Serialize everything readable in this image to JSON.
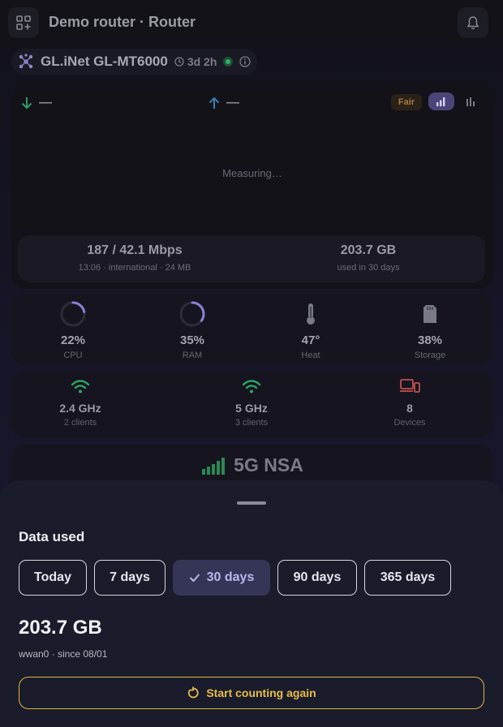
{
  "header": {
    "title": "Demo router · Router",
    "menu_icon": "apps-grid-icon",
    "bell_icon": "bell-icon"
  },
  "device": {
    "name": "GL.iNet GL-MT6000",
    "uptime": "3d 2h",
    "status": "online"
  },
  "speed": {
    "download_value": "—",
    "upload_value": "—",
    "quality_badge": "Fair",
    "measuring_text": "Measuring…",
    "last_test": {
      "value": "187 / 42.1 Mbps",
      "detail": "13:06 · international · 24 MB"
    },
    "usage": {
      "value": "203.7 GB",
      "detail": "used in 30 days"
    }
  },
  "resources": [
    {
      "value": "22%",
      "label": "CPU",
      "level": 0.22
    },
    {
      "value": "35%",
      "label": "RAM",
      "level": 0.35
    },
    {
      "value": "47°",
      "label": "Heat"
    },
    {
      "value": "38%",
      "label": "Storage"
    }
  ],
  "network": [
    {
      "value": "2.4 GHz",
      "label": "2 clients"
    },
    {
      "value": "5 GHz",
      "label": "3 clients"
    },
    {
      "value": "8",
      "label": "Devices"
    }
  ],
  "cellular": {
    "mode": "5G NSA",
    "signal_bars": 5
  },
  "sheet": {
    "title": "Data used",
    "ranges": [
      {
        "label": "Today",
        "selected": false
      },
      {
        "label": "7 days",
        "selected": false
      },
      {
        "label": "30 days",
        "selected": true
      },
      {
        "label": "90 days",
        "selected": false
      },
      {
        "label": "365 days",
        "selected": false
      }
    ],
    "total": "203.7 GB",
    "subtitle": "wwan0 · since 08/01",
    "reset_label": "Start counting again"
  },
  "colors": {
    "accent_purple": "#b9b6f0",
    "status_green": "#2fb36a",
    "reset_amber": "#e7bd48",
    "download_arrow": "#2a9d6a",
    "upload_arrow": "#3b7fb0",
    "devices_red": "#c0504f"
  }
}
